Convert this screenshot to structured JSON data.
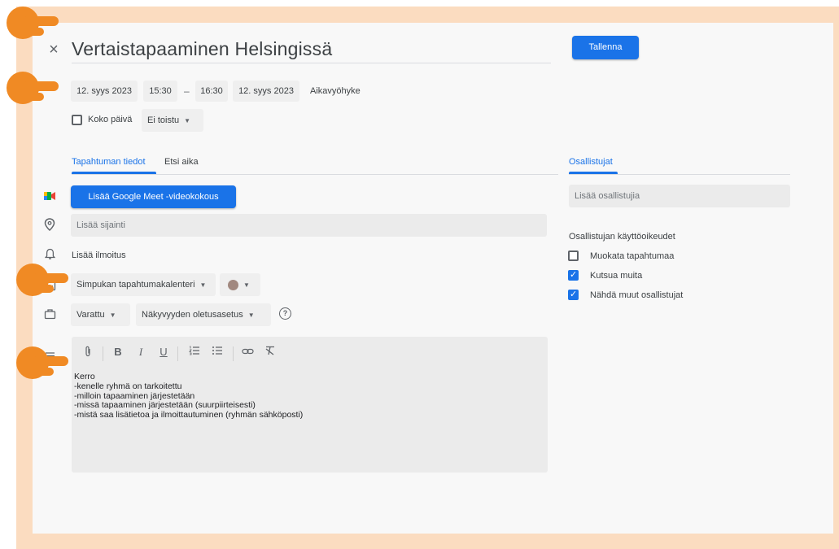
{
  "header": {
    "close_glyph": "×",
    "title": "Vertaistapaaminen Helsingissä",
    "save_label": "Tallenna"
  },
  "datetime": {
    "start_date": "12. syys 2023",
    "start_time": "15:30",
    "separator": "–",
    "end_time": "16:30",
    "end_date": "12. syys 2023",
    "timezone_label": "Aikavyöhyke",
    "all_day_label": "Koko päivä",
    "all_day_checked": false,
    "repeat_value": "Ei toistu"
  },
  "tabs": [
    {
      "label": "Tapahtuman tiedot",
      "active": true
    },
    {
      "label": "Etsi aika",
      "active": false
    }
  ],
  "details": {
    "meet_button": "Lisää Google Meet -videokokous",
    "location_placeholder": "Lisää sijainti",
    "notification_label": "Lisää ilmoitus",
    "calendar_value": "Simpukan tapahtumakalenteri",
    "color_value": "#a1887f",
    "availability_value": "Varattu",
    "visibility_value": "Näkyvyyden oletusasetus",
    "help_glyph": "?"
  },
  "editor": {
    "toolbar": [
      "attachment-icon",
      "bold-icon",
      "italic-icon",
      "underline-icon",
      "numbered-list-icon",
      "bulleted-list-icon",
      "link-icon",
      "clear-formatting-icon"
    ],
    "bold_glyph": "B",
    "italic_glyph": "I",
    "underline_glyph": "U",
    "description": "Kerro\n-kenelle ryhmä on tarkoitettu\n-milloin tapaaminen järjestetään\n-missä tapaaminen järjestetään (suurpiirteisesti)\n-mistä saa lisätietoa ja ilmoittautuminen (ryhmän sähköposti)"
  },
  "guests": {
    "tab_label": "Osallistujat",
    "add_placeholder": "Lisää osallistujia",
    "permissions_title": "Osallistujan käyttöoikeudet",
    "permissions": [
      {
        "label": "Muokata tapahtumaa",
        "checked": false
      },
      {
        "label": "Kutsua muita",
        "checked": true
      },
      {
        "label": "Nähdä muut osallistujat",
        "checked": true
      }
    ]
  },
  "colors": {
    "accent": "#1a73e8",
    "frame": "#fbdcc0",
    "hand": "#f08a24"
  }
}
